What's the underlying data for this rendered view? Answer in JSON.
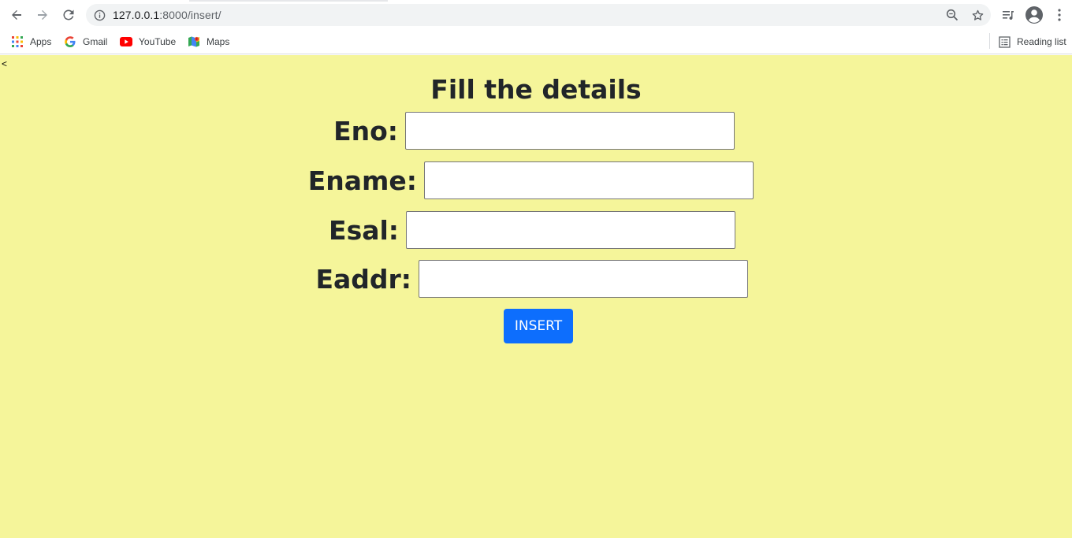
{
  "browser": {
    "url_host": "127.0.0.1",
    "url_path": ":8000/insert/",
    "bookmarks": [
      {
        "label": "Apps",
        "icon": "apps-grid-icon"
      },
      {
        "label": "Gmail",
        "icon": "google-icon"
      },
      {
        "label": "YouTube",
        "icon": "youtube-icon"
      },
      {
        "label": "Maps",
        "icon": "maps-icon"
      }
    ],
    "reading_list": "Reading list"
  },
  "page": {
    "stray_text": "<",
    "heading": "Fill the details",
    "fields": [
      {
        "label": "Eno:",
        "value": ""
      },
      {
        "label": "Ename:",
        "value": ""
      },
      {
        "label": "Esal:",
        "value": ""
      },
      {
        "label": "Eaddr:",
        "value": ""
      }
    ],
    "submit_label": "INSERT",
    "colors": {
      "background": "#f5f59a",
      "button": "#0d6efd",
      "text": "#212529"
    }
  }
}
